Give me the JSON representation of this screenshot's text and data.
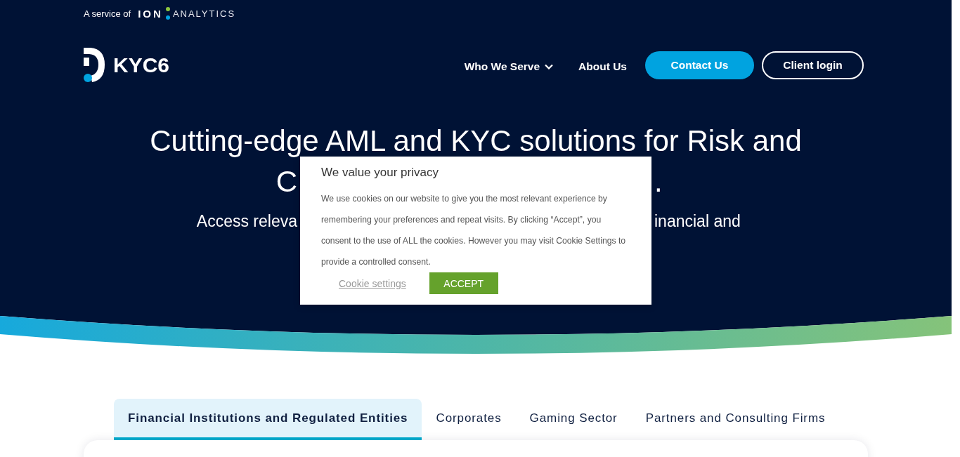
{
  "header": {
    "service_label": "A service of",
    "partner_logo": {
      "mark": "ION",
      "word": "ANALYTICS"
    },
    "logo_text": "KYC6"
  },
  "nav": {
    "items": [
      {
        "label": "Who We Serve",
        "has_dropdown": true
      },
      {
        "label": "About Us",
        "has_dropdown": false
      }
    ],
    "buttons": [
      {
        "label": "Contact Us",
        "kind": "primary"
      },
      {
        "label": "Client login",
        "kind": "outline"
      }
    ]
  },
  "hero": {
    "heading": "Cutting-edge AML and KYC solutions for Risk and",
    "heading_fragments": [
      "C",
      "."
    ],
    "subtitle_fragments": [
      "Access releva",
      "inancial and"
    ]
  },
  "cookie_banner": {
    "title": "We value your privacy",
    "text": "We use cookies on our website to give you the most relevant experience by remembering your preferences and repeat visits. By clicking “Accept”, you consent to the use of ALL the cookies. However you may visit Cookie Settings to provide a controlled consent.",
    "settings_link": "Cookie settings",
    "accept_button": "ACCEPT"
  },
  "tabs": [
    {
      "label": "Financial Institutions and Regulated Entities",
      "selected": true
    },
    {
      "label": "Corporates",
      "selected": false
    },
    {
      "label": "Gaming Sector",
      "selected": false
    },
    {
      "label": "Partners and Consulting Firms",
      "selected": false
    }
  ]
}
